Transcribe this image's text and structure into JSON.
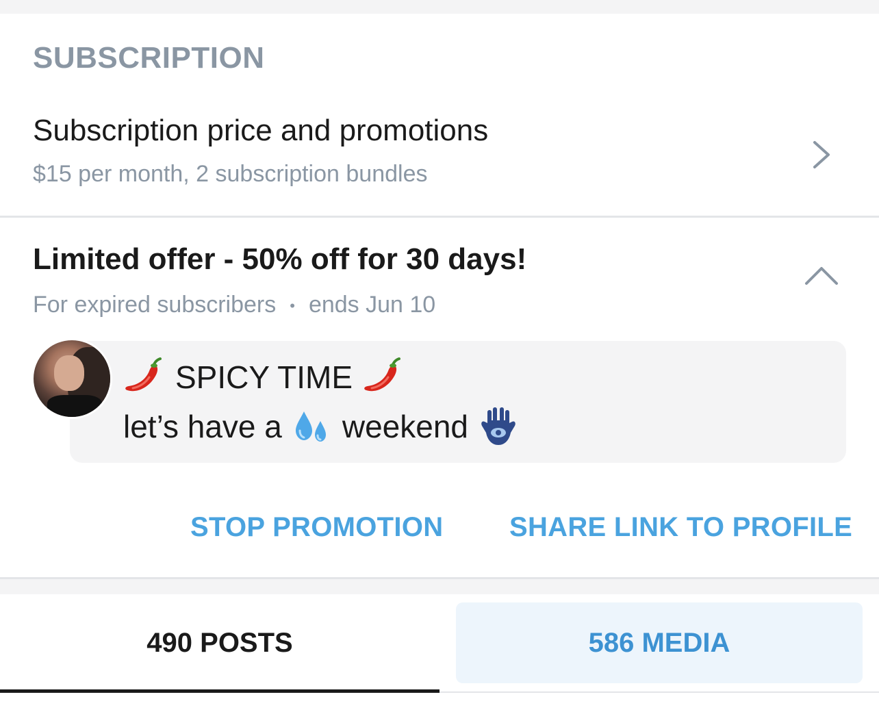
{
  "section": {
    "header": "SUBSCRIPTION"
  },
  "subscription_row": {
    "title": "Subscription price and promotions",
    "subtitle": "$15 per month, 2 subscription bundles",
    "icon": "chevron-right-icon"
  },
  "promotion": {
    "title": "Limited offer - 50% off for 30 days!",
    "audience": "For expired subscribers",
    "separator": "•",
    "ends": "ends Jun 10",
    "icon": "chevron-up-icon",
    "message": {
      "line1_text": "SPICY TIME",
      "line1_emoji": "hot-pepper-icon",
      "line2_prefix": "let’s have a",
      "line2_emoji_mid": "sweat-droplets-icon",
      "line2_suffix": "weekend",
      "line2_emoji_end": "hamsa-icon"
    },
    "actions": {
      "stop": "STOP PROMOTION",
      "share": "SHARE LINK TO PROFILE"
    }
  },
  "tabs": {
    "posts": "490 POSTS",
    "media": "586 MEDIA",
    "active": "posts"
  },
  "colors": {
    "accent": "#4aa3df",
    "muted": "#8a96a3",
    "bubble_bg": "#f4f4f5",
    "divider": "#e3e5e8"
  }
}
